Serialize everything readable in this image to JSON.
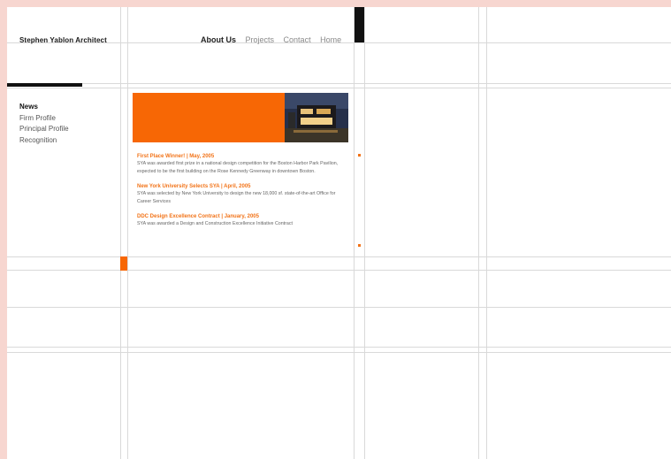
{
  "site": {
    "logo_text": "Stephen Yablon Architect"
  },
  "top_nav": [
    {
      "label": "About Us",
      "active": true
    },
    {
      "label": "Projects",
      "active": false
    },
    {
      "label": "Contact",
      "active": false
    },
    {
      "label": "Home",
      "active": false
    }
  ],
  "side_nav": [
    {
      "label": "News",
      "active": true
    },
    {
      "label": "Firm Profile",
      "active": false
    },
    {
      "label": "Principal Profile",
      "active": false
    },
    {
      "label": "Recognition",
      "active": false
    }
  ],
  "news": [
    {
      "heading": "First Place Winner!  |  May, 2005",
      "body": "SYA was awarded first prize in a national design competition for the Boston Harbor Park Pavilion, expected to be the first building on the Rose Kennedy Greenway in downtown Boston."
    },
    {
      "heading": "New York University Selects SYA  |  April, 2005",
      "body": "SYA was selected by New York University to design the new 18,000 sf. state-of-the-art Office for Career Services"
    },
    {
      "heading": "DDC Design Excellence Contract  |  January, 2005",
      "body": "SYA was awarded a Design and Construction Excellence Initiative Contract"
    }
  ],
  "colors": {
    "accent": "#f76705",
    "background_border": "#f7d6d0",
    "grid_line": "#d9d9d9"
  }
}
